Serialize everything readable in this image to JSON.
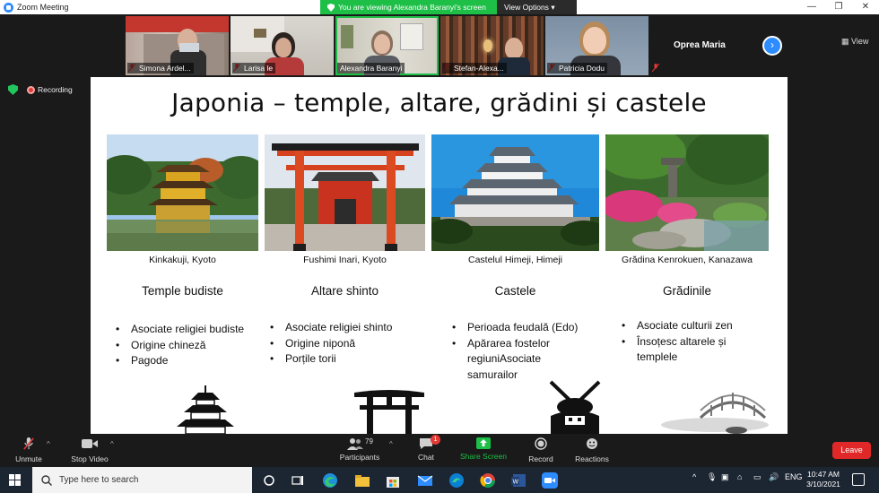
{
  "window": {
    "app_title": "Zoom Meeting",
    "share_banner": "You are viewing Alexandra Baranyi's screen",
    "view_options": "View Options",
    "minimize": "—",
    "maximize": "❐",
    "close": "✕"
  },
  "participants_strip": {
    "tiles": [
      {
        "name": "Simona Ardel..."
      },
      {
        "name": "Larisa   le"
      },
      {
        "name": "Alexandra Baranyi"
      },
      {
        "name": "Stefan-Alexa..."
      },
      {
        "name": "Patricia Dodu"
      }
    ],
    "name_card": "Oprea Maria",
    "next_label": "›",
    "view_label": "View"
  },
  "status": {
    "recording": "Recording"
  },
  "slide": {
    "title": "Japonia – temple, altare, grădini și castele",
    "columns": [
      {
        "caption": "Kinkakuji, Kyoto",
        "heading": "Temple budiste",
        "bullets": [
          "Asociate religiei budiste",
          "Origine chineză",
          "Pagode"
        ]
      },
      {
        "caption": "Fushimi Inari, Kyoto",
        "heading": "Altare shinto",
        "bullets": [
          "Asociate religiei shinto",
          "Origine niponă",
          "Porțile torii"
        ]
      },
      {
        "caption": "Castelul Himeji, Himeji",
        "heading": "Castele",
        "bullets": [
          "Perioada feudală (Edo)",
          "Apărarea fostelor regiuniAsociate samurailor"
        ]
      },
      {
        "caption": "Grădina Kenrokuen, Kanazawa",
        "heading": "Grădinile",
        "bullets": [
          "Asociate culturii zen",
          "Însoțesc altarele și templele"
        ]
      }
    ]
  },
  "toolbar": {
    "unmute": "Unmute",
    "stop_video": "Stop Video",
    "participants": "Participants",
    "participants_count": "79",
    "chat": "Chat",
    "chat_badge": "1",
    "share_screen": "Share Screen",
    "record": "Record",
    "reactions": "Reactions",
    "leave": "Leave"
  },
  "taskbar": {
    "search_placeholder": "Type here to search",
    "language": "ENG",
    "time": "10:47 AM",
    "date": "3/10/2021"
  },
  "colors": {
    "zoom_blue": "#2d8cff",
    "share_green": "#1dbf47",
    "leave_red": "#e02828",
    "taskbar": "#1c2532"
  }
}
